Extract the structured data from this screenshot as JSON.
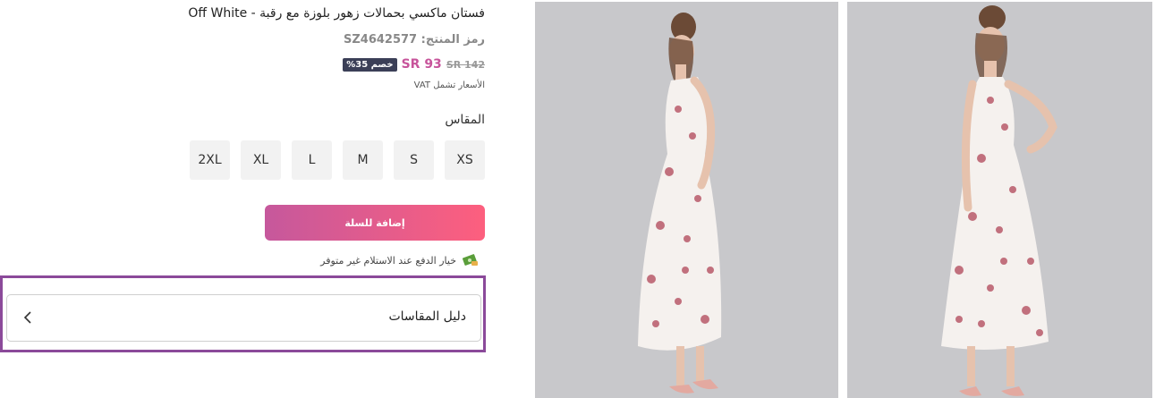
{
  "product": {
    "title": "فستان ماكسي بحمالات زهور بلوزة مع رقبة - Off White",
    "sku": "رمز المنتج: SZ4642577",
    "old_price": "SR 142",
    "new_price": "SR 93",
    "discount": "خصم 35%",
    "vat_note": "الأسعار تشمل VAT"
  },
  "sizes": {
    "label": "المقاس",
    "options": [
      "XS",
      "S",
      "M",
      "L",
      "XL",
      "2XL"
    ]
  },
  "actions": {
    "add_to_cart": "إضافة للسلة",
    "cod_note": "خيار الدفع عند الاستلام غير متوفر"
  },
  "size_guide": {
    "label": "دليل المقاسات"
  },
  "colors": {
    "accent_start": "#c6589c",
    "accent_end": "#fd5f7e",
    "price": "#c7549b",
    "discount_bg": "#3b3f57",
    "highlight_border": "#8b4a9a"
  }
}
